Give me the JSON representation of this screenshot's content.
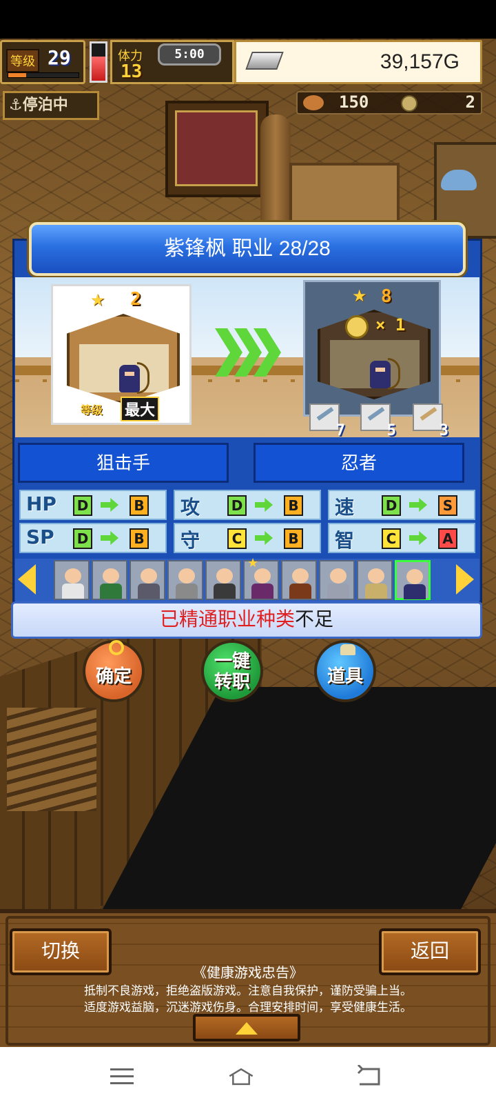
{
  "hud": {
    "level_label": "等级",
    "level": "29",
    "level_progress": 0.25,
    "stamina_label": "体力",
    "stamina": "13",
    "stamina_fill": 0.65,
    "clock": "5:00",
    "gold": "39,157G",
    "status": "停泊中",
    "food": "150",
    "medals": "2"
  },
  "dialog": {
    "title": "紫锋枫  职业 28/28",
    "current": {
      "stars": "2",
      "level_label": "等级",
      "level_value": "最大"
    },
    "next": {
      "stars": "8",
      "cost": "× 1",
      "equip": [
        "7",
        "5",
        "3"
      ]
    },
    "current_job": "狙击手",
    "new_job": "忍者",
    "stats": [
      {
        "name": "HP",
        "from": "D",
        "to": "B"
      },
      {
        "name": "攻",
        "from": "D",
        "to": "B"
      },
      {
        "name": "速",
        "from": "D",
        "to": "S"
      },
      {
        "name": "SP",
        "from": "D",
        "to": "B"
      },
      {
        "name": "守",
        "from": "C",
        "to": "B"
      },
      {
        "name": "智",
        "from": "C",
        "to": "A"
      }
    ],
    "notice_red": "已精通职业种类",
    "notice_rest": "不足"
  },
  "actions": {
    "confirm": "确定",
    "one_click_1": "一键",
    "one_click_2": "转职",
    "items": "道具"
  },
  "bottom": {
    "switch": "切换",
    "back": "返回",
    "advice_title": "《健康游戏忠告》",
    "advice_line1": "抵制不良游戏，拒绝盗版游戏。注意自我保护，谨防受骗上当。",
    "advice_line2": "适度游戏益脑，沉迷游戏伤身。合理安排时间，享受健康生活。"
  },
  "colors": {
    "grade_D": "#7ee04a",
    "grade_C": "#ffe23a",
    "grade_B": "#ffb020",
    "grade_S": "#ff9a3a",
    "grade_A": "#ff4a4a"
  }
}
